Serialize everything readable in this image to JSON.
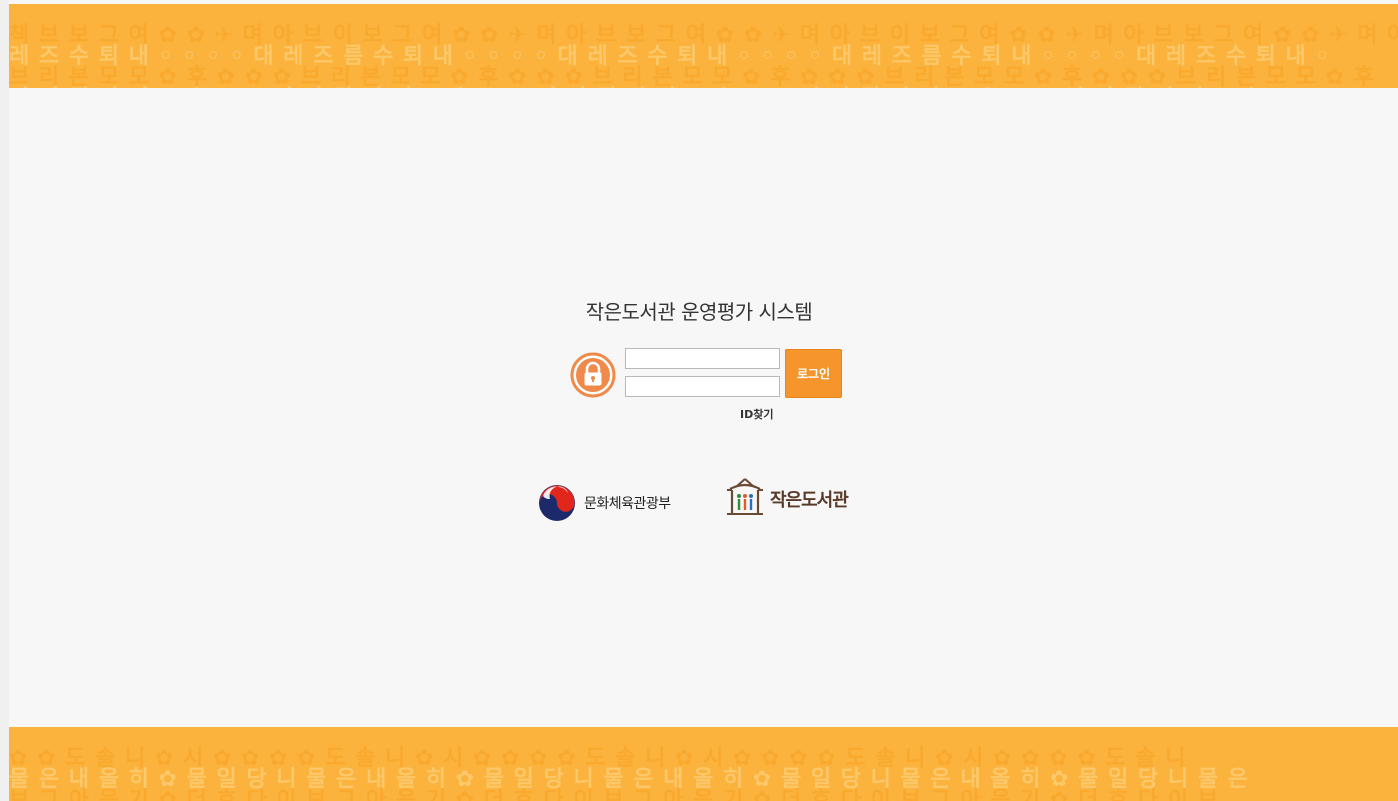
{
  "header": {
    "title": "작은도서관 운영평가 시스템"
  },
  "login": {
    "id_value": "",
    "password_value": "",
    "button_label": "로그인",
    "find_id_label": "ID찾기"
  },
  "logos": {
    "ministry_name": "문화체육관광부",
    "library_name": "작은도서관"
  },
  "icons": {
    "lock": "lock-icon",
    "ministry": "taegeuk-emblem-icon",
    "library": "small-library-emblem-icon"
  },
  "colors": {
    "banner": "#fbb33d",
    "accent": "#f5952b",
    "lock": "#ef8a4a",
    "background": "#f7f7f7"
  }
}
